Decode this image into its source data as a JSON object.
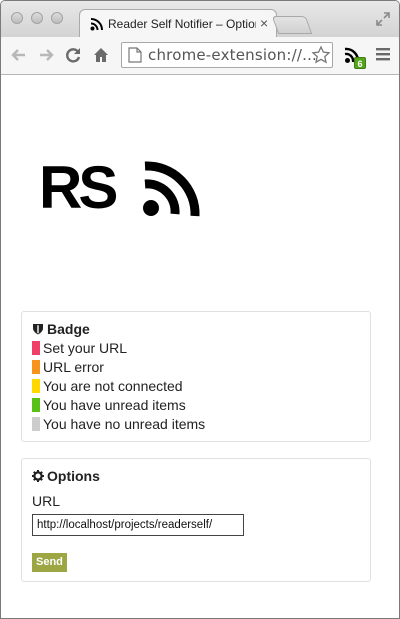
{
  "browser": {
    "tab_title": "Reader Self Notifier – Options",
    "url": "chrome-extension://...",
    "extension_badge": "6"
  },
  "logo": {
    "text": "RS"
  },
  "badge_panel": {
    "title": "Badge",
    "icon": "shield-icon",
    "items": [
      {
        "label": "Set your URL",
        "color": "#f0406a"
      },
      {
        "label": "URL error",
        "color": "#f7941d"
      },
      {
        "label": "You are not connected",
        "color": "#ffd800"
      },
      {
        "label": "You have unread items",
        "color": "#59c01a"
      },
      {
        "label": "You have no unread items",
        "color": "#cccccc"
      }
    ]
  },
  "options_panel": {
    "title": "Options",
    "icon": "gear-icon",
    "url_label": "URL",
    "url_value": "http://localhost/projects/readerself/",
    "send_label": "Send"
  },
  "colors": {
    "accent": "#9ca744",
    "extension_badge": "#55a51c"
  }
}
